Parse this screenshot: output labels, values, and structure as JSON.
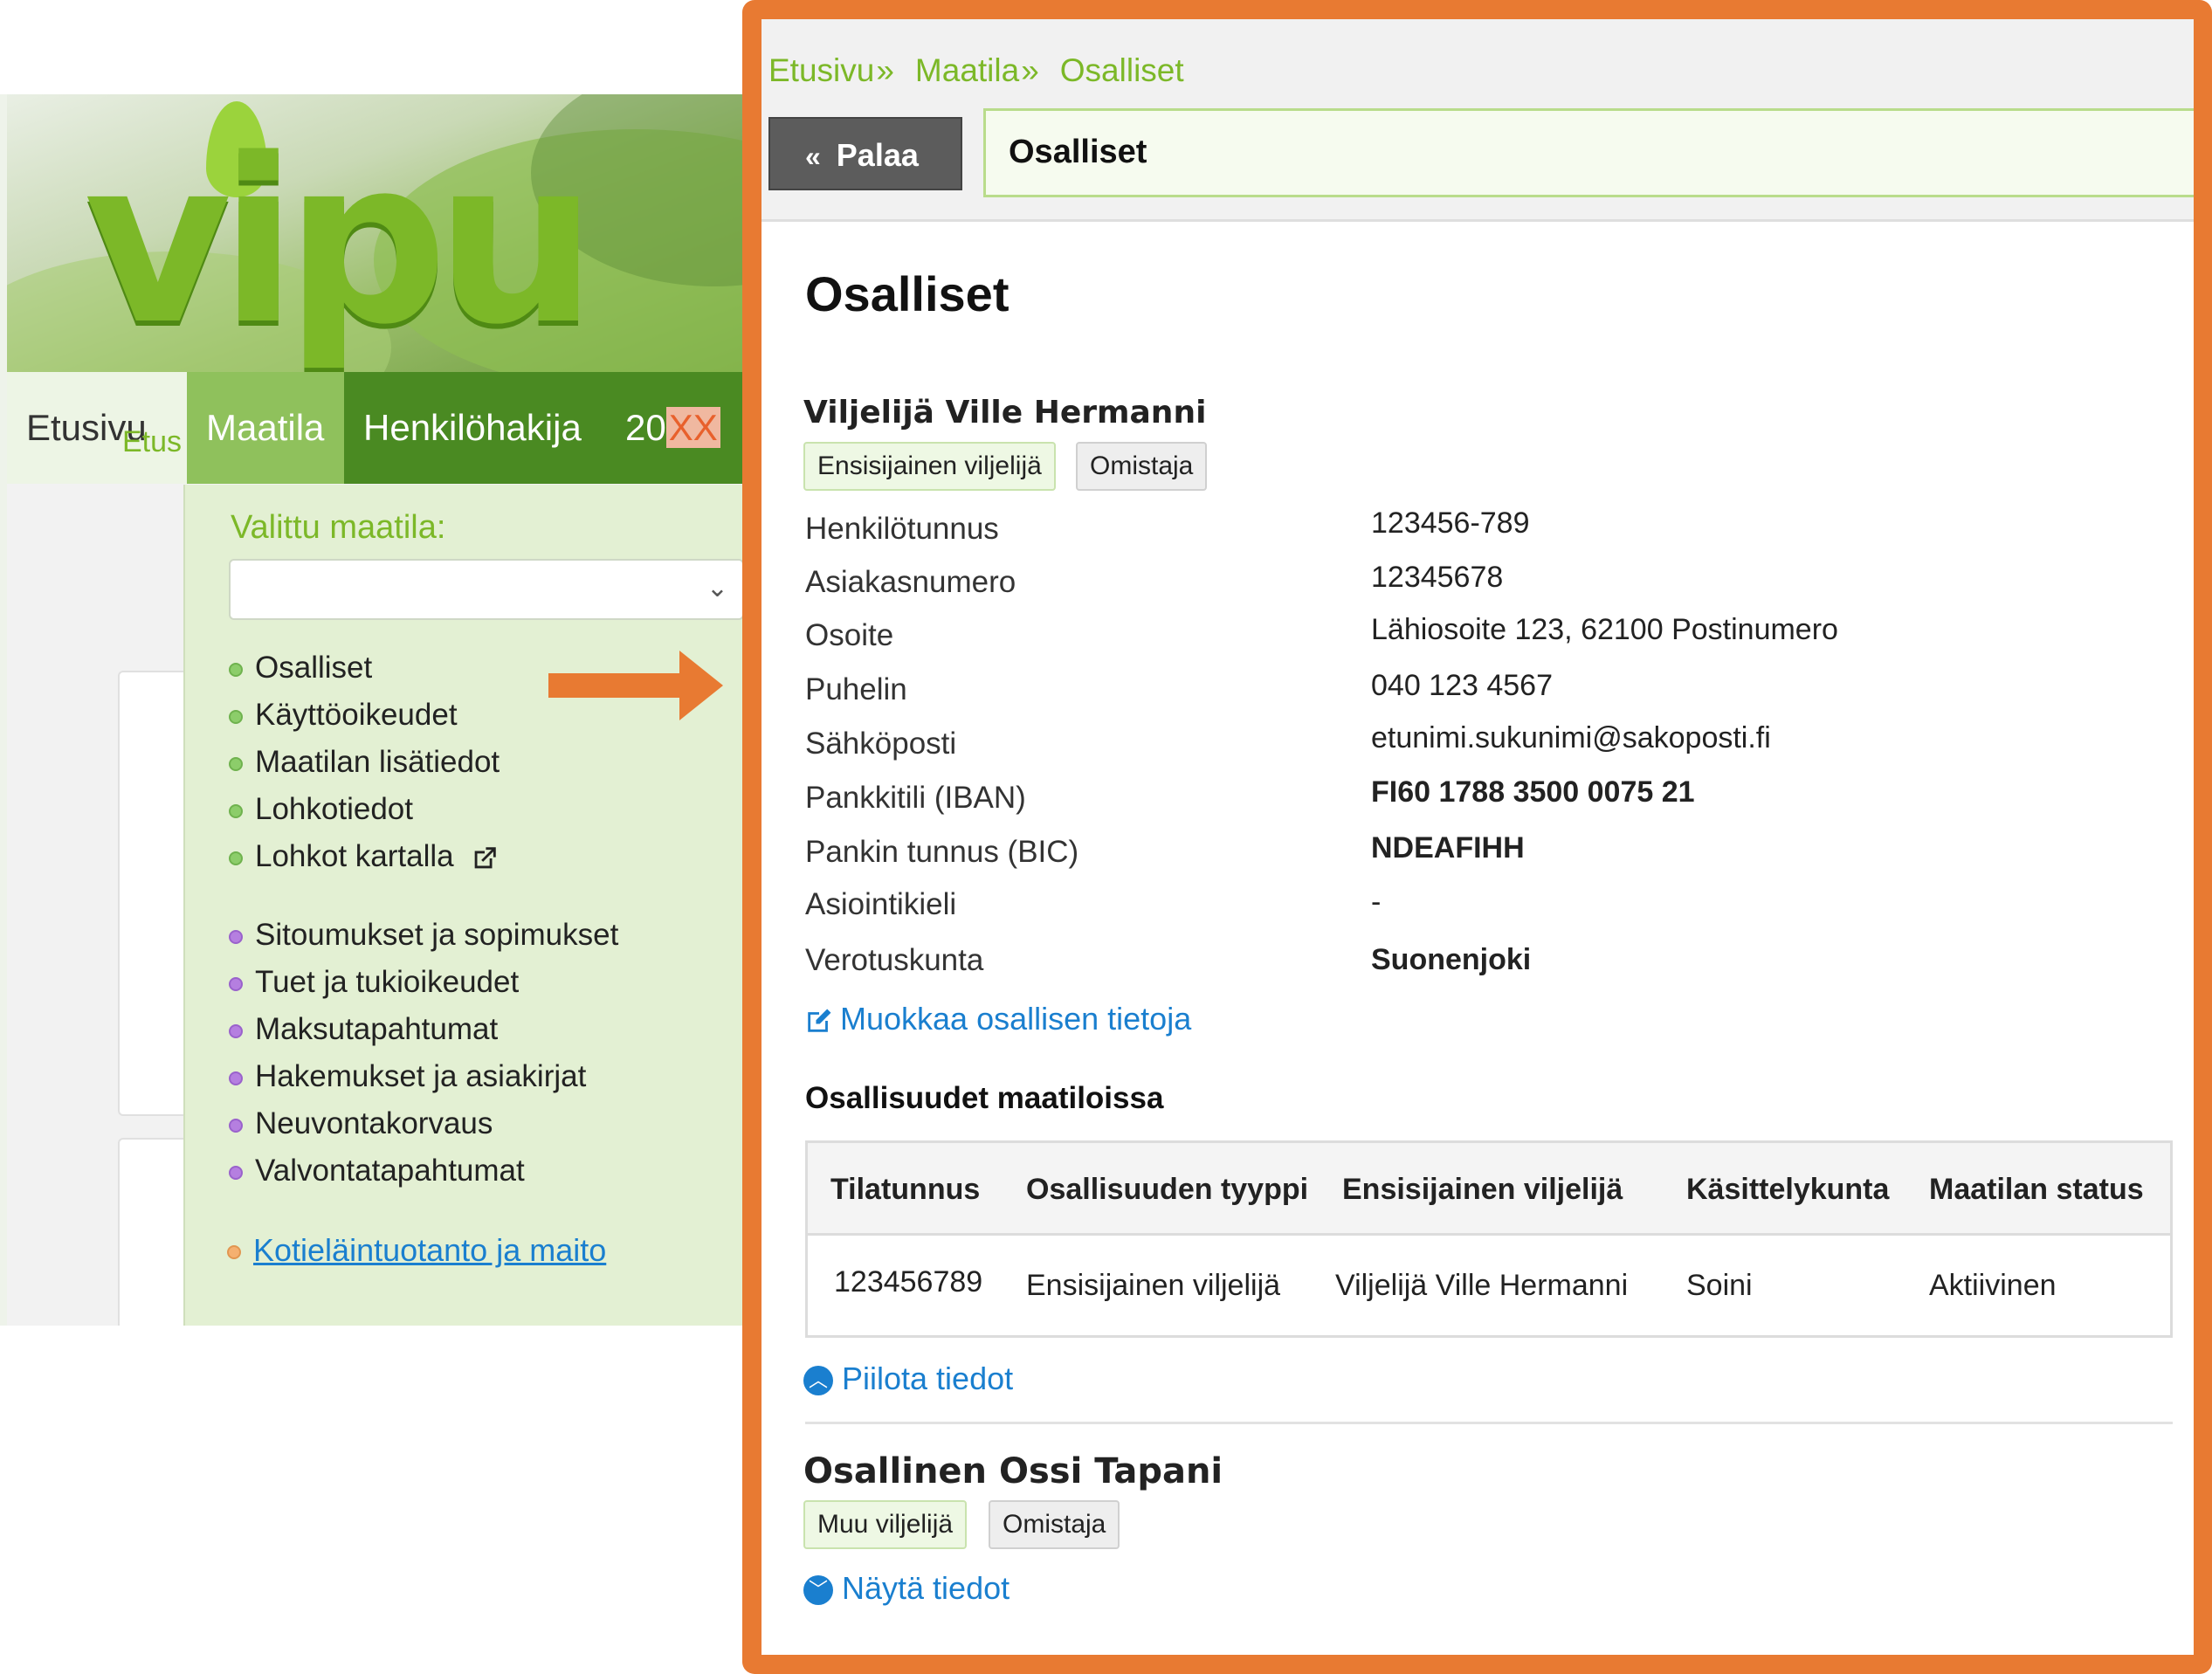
{
  "background_app": {
    "logo_text": "vipu",
    "nav": {
      "etusivu": "Etusivu",
      "maatila": "Maatila",
      "henkilohakija": "Henkilöhakija",
      "year_prefix": "20",
      "year_suffix": "XX"
    },
    "left_crumb": "Etus",
    "menu": {
      "label": "Valittu maatila:",
      "select_value": "",
      "items_group1": [
        "Osalliset",
        "Käyttöoikeudet",
        "Maatilan lisätiedot",
        "Lohkotiedot",
        "Lohkot kartalla"
      ],
      "items_group2": [
        "Sitoumukset ja sopimukset",
        "Tuet ja tukioikeudet",
        "Maksutapahtumat",
        "Hakemukset ja asiakirjat",
        "Neuvontakorvaus",
        "Valvontatapahtumat"
      ],
      "items_group3": [
        "Kotieläintuotanto ja maito"
      ]
    }
  },
  "panel": {
    "breadcrumb": [
      "Etusivu",
      "Maatila",
      "Osalliset"
    ],
    "breadcrumb_sep": "»",
    "back_button": "Palaa",
    "title_bar": "Osalliset",
    "page_title": "Osalliset",
    "person1": {
      "name": "Viljelijä Ville Hermanni",
      "badges": [
        "Ensisijainen viljelijä",
        "Omistaja"
      ],
      "fields": [
        {
          "label": "Henkilötunnus",
          "value": "123456-789"
        },
        {
          "label": "Asiakasnumero",
          "value": "12345678"
        },
        {
          "label": "Osoite",
          "value": "Lähiosoite 123, 62100 Postinumero"
        },
        {
          "label": "Puhelin",
          "value": "040 123 4567"
        },
        {
          "label": "Sähköposti",
          "value": "etunimi.sukunimi@sakoposti.fi"
        },
        {
          "label": "Pankkitili (IBAN)",
          "value": "FI60 1788 3500 0075 21"
        },
        {
          "label": "Pankin tunnus (BIC)",
          "value": "NDEAFIHH"
        },
        {
          "label": "Asiointikieli",
          "value": "-"
        },
        {
          "label": "Verotuskunta",
          "value": "Suonenjoki"
        }
      ],
      "edit_link": "Muokkaa osallisen tietoja"
    },
    "ownership": {
      "title": "Osallisuudet maatiloissa",
      "columns": [
        "Tilatunnus",
        "Osallisuuden tyyppi",
        "Ensisijainen viljelijä",
        "Käsittelykunta",
        "Maatilan status"
      ],
      "rows": [
        [
          "123456789",
          "Ensisijainen viljelijä",
          "Viljelijä Ville Hermanni",
          "Soini",
          "Aktiivinen"
        ]
      ]
    },
    "hide_link": "Piilota tiedot",
    "person2": {
      "name": "Osallinen Ossi Tapani",
      "badges": [
        "Muu viljelijä",
        "Omistaja"
      ],
      "show_link": "Näytä tiedot"
    }
  },
  "colors": {
    "frame": "#e87a32",
    "brand_green": "#7cb828",
    "nav_green": "#4a8a22",
    "link_blue": "#1a7fcf"
  }
}
